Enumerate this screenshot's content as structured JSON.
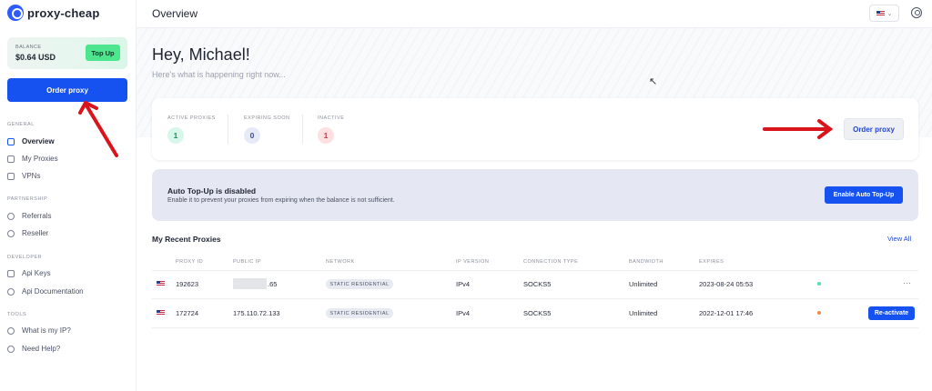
{
  "app": {
    "brand": "proxy-cheap"
  },
  "balance": {
    "label": "BALANCE",
    "value": "$0.64 USD",
    "topup_label": "Top Up"
  },
  "sidebar": {
    "order_label": "Order proxy",
    "sections": [
      {
        "title": "GENERAL",
        "items": [
          {
            "label": "Overview",
            "icon": "overview-icon",
            "active": true
          },
          {
            "label": "My Proxies",
            "icon": "proxies-icon",
            "active": false
          },
          {
            "label": "VPNs",
            "icon": "vpn-icon",
            "active": false
          }
        ]
      },
      {
        "title": "PARTNERSHIP",
        "items": [
          {
            "label": "Referrals",
            "icon": "dollar-icon",
            "active": false
          },
          {
            "label": "Reseller",
            "icon": "reseller-icon",
            "active": false
          }
        ]
      },
      {
        "title": "DEVELOPER",
        "items": [
          {
            "label": "Api Keys",
            "icon": "key-icon",
            "active": false
          },
          {
            "label": "Api Documentation",
            "icon": "doc-icon",
            "active": false
          }
        ]
      },
      {
        "title": "TOOLS",
        "items": [
          {
            "label": "What is my IP?",
            "icon": "pin-icon",
            "active": false
          },
          {
            "label": "Need Help?",
            "icon": "help-icon",
            "active": false
          }
        ]
      }
    ]
  },
  "topbar": {
    "title": "Overview",
    "language_flag": "us-flag-icon"
  },
  "main": {
    "greeting": "Hey, Michael!",
    "subgreeting": "Here's what is happening right now...",
    "stats": [
      {
        "label": "ACTIVE PROXIES",
        "value": "1",
        "color": "#d6f7ea",
        "text": "#1d8f5b"
      },
      {
        "label": "EXPIRING SOON",
        "value": "0",
        "color": "#e6eaf7",
        "text": "#3f4f8c"
      },
      {
        "label": "INACTIVE",
        "value": "1",
        "color": "#fde0e2",
        "text": "#c23c4c"
      }
    ],
    "order_label": "Order proxy",
    "banner": {
      "title": "Auto Top-Up is disabled",
      "subtitle": "Enable it to prevent your proxies from expiring when the balance is not sufficient.",
      "button": "Enable Auto Top-Up"
    },
    "recent": {
      "title": "My Recent Proxies",
      "view_all": "View All",
      "columns": [
        "PROXY ID",
        "PUBLIC IP",
        "NETWORK",
        "IP VERSION",
        "CONNECTION TYPE",
        "BANDWIDTH",
        "EXPIRES"
      ],
      "rows": [
        {
          "id": "192623",
          "ip": ".65",
          "network": "STATIC RESIDENTIAL",
          "ipv": "IPv4",
          "conn": "SOCKS5",
          "bandwidth": "Unlimited",
          "expires": "2023-08-24 05:53",
          "status_color": "#4ee5a5",
          "action": "···"
        },
        {
          "id": "172724",
          "ip": "175.110.72.133",
          "network": "STATIC RESIDENTIAL",
          "ipv": "IPv4",
          "conn": "SOCKS5",
          "bandwidth": "Unlimited",
          "expires": "2022-12-01 17:46",
          "status_color": "#f08a4b",
          "action": "Re-activate"
        }
      ]
    }
  },
  "colors": {
    "primary": "#1652f0",
    "accent_green": "#4ee58f",
    "annotation_red": "#d9141c"
  }
}
